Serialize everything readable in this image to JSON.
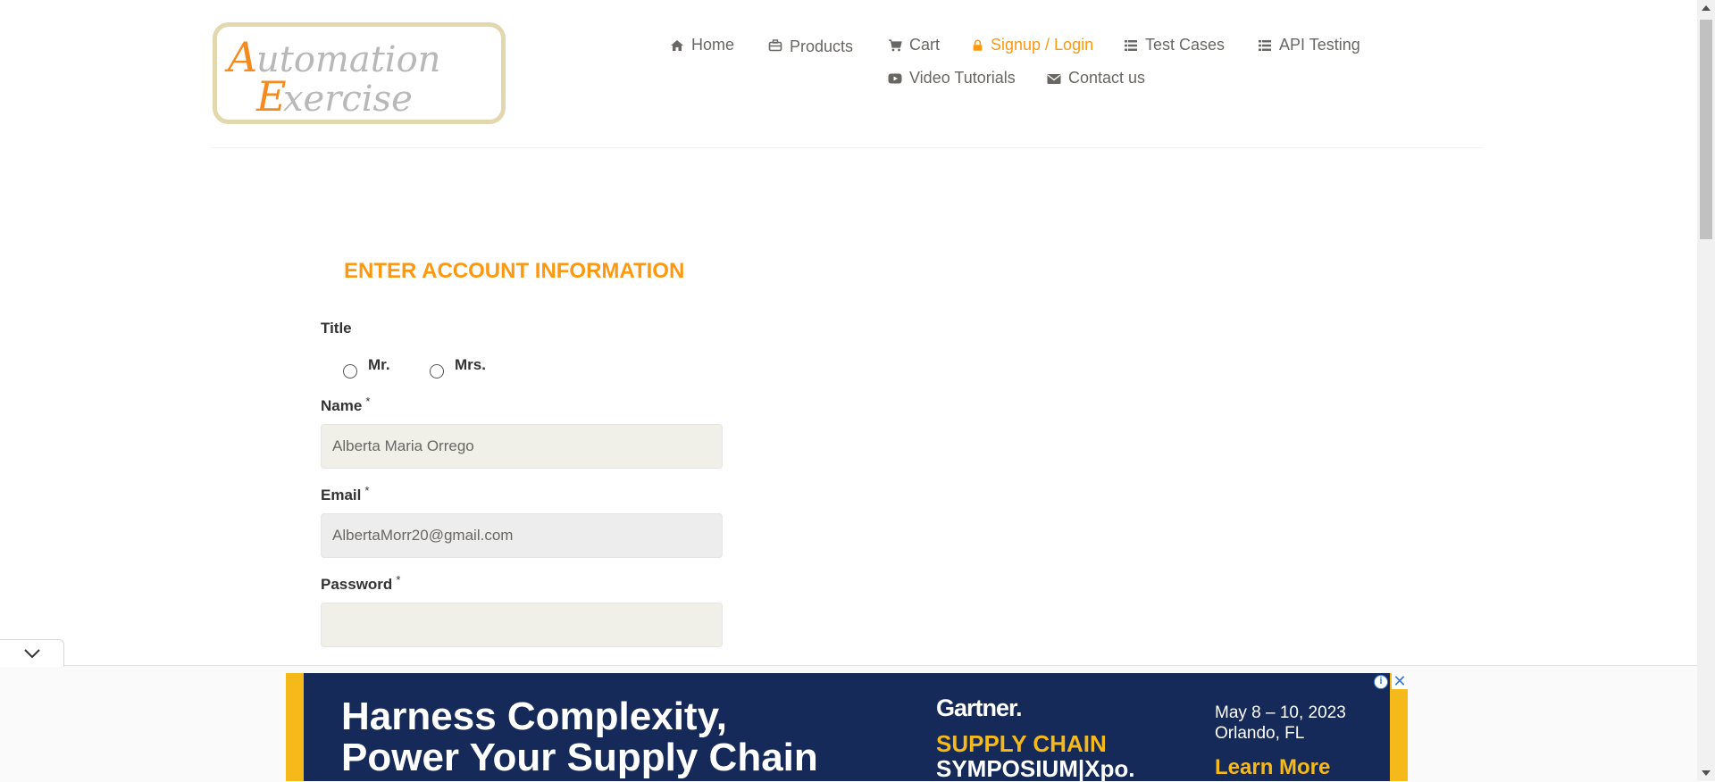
{
  "logo": {
    "text_line1": "Automation",
    "text_line2": "Exercise"
  },
  "nav": [
    {
      "label": "Home",
      "icon": "home-icon"
    },
    {
      "label": "Products",
      "icon": "briefcase-icon"
    },
    {
      "label": "Cart",
      "icon": "cart-icon"
    },
    {
      "label": "Signup / Login",
      "icon": "lock-icon",
      "active": true
    },
    {
      "label": "Test Cases",
      "icon": "list-icon"
    },
    {
      "label": "API Testing",
      "icon": "list-icon"
    },
    {
      "label": "Video Tutorials",
      "icon": "youtube-play-icon"
    },
    {
      "label": "Contact us",
      "icon": "envelope-icon"
    }
  ],
  "form": {
    "heading": "ENTER ACCOUNT INFORMATION",
    "title_label": "Title",
    "title_options": [
      "Mr.",
      "Mrs."
    ],
    "name_label": "Name",
    "name_value": "Alberta Maria Orrego",
    "email_label": "Email",
    "email_value": "AlbertaMorr20@gmail.com",
    "password_label": "Password",
    "password_value": "",
    "required_mark": "*"
  },
  "ad": {
    "headline_line1": "Harness Complexity,",
    "headline_line2": "Power Your Supply Chain",
    "brand": "Gartner.",
    "event_line1": "SUPPLY CHAIN",
    "event_line2": "SYMPOSIUM|Xpo.",
    "date": "May 8 – 10, 2023",
    "location": "Orlando, FL",
    "cta": "Learn More",
    "info_icon": "info-icon",
    "close_icon": "close-icon"
  },
  "colors": {
    "accent": "#fe980f",
    "text": "#696763",
    "ad_navy": "#152a58",
    "ad_gold": "#f6b91a"
  }
}
